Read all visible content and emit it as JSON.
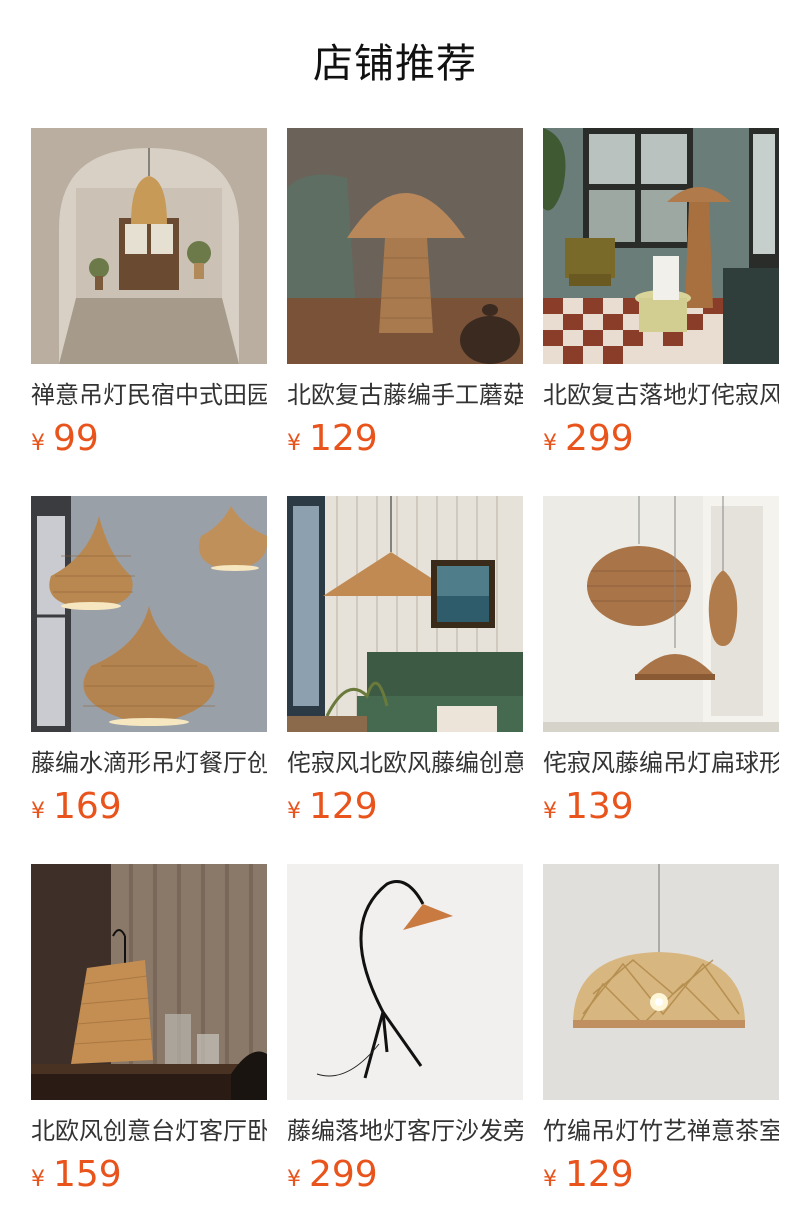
{
  "section": {
    "title": "店铺推荐"
  },
  "currency_symbol": "¥",
  "colors": {
    "price": "#e8541c",
    "title": "#111111"
  },
  "products": [
    {
      "name": "禅意吊灯民宿中式田园藤编",
      "price": "99",
      "image": "rattan-pendant-arch-room"
    },
    {
      "name": "北欧复古藤编手工蘑菇台灯",
      "price": "129",
      "image": "rattan-mushroom-table-lamp"
    },
    {
      "name": "北欧复古落地灯侘寂风客厅",
      "price": "299",
      "image": "rattan-floor-lamp-checker-floor"
    },
    {
      "name": "藤编水滴形吊灯餐厅创意",
      "price": "169",
      "image": "rattan-teardrop-pendants"
    },
    {
      "name": "侘寂风北欧风藤编创意吊灯",
      "price": "129",
      "image": "rattan-cone-pendant-green-sofa"
    },
    {
      "name": "侘寂风藤编吊灯扁球形",
      "price": "139",
      "image": "rattan-globe-pendants"
    },
    {
      "name": "北欧风创意台灯客厅卧室",
      "price": "159",
      "image": "rattan-tripod-table-lamp"
    },
    {
      "name": "藤编落地灯客厅沙发旁",
      "price": "299",
      "image": "arc-floor-lamp-rattan-shade"
    },
    {
      "name": "竹编吊灯竹艺禅意茶室",
      "price": "129",
      "image": "bamboo-dome-pendant"
    }
  ]
}
